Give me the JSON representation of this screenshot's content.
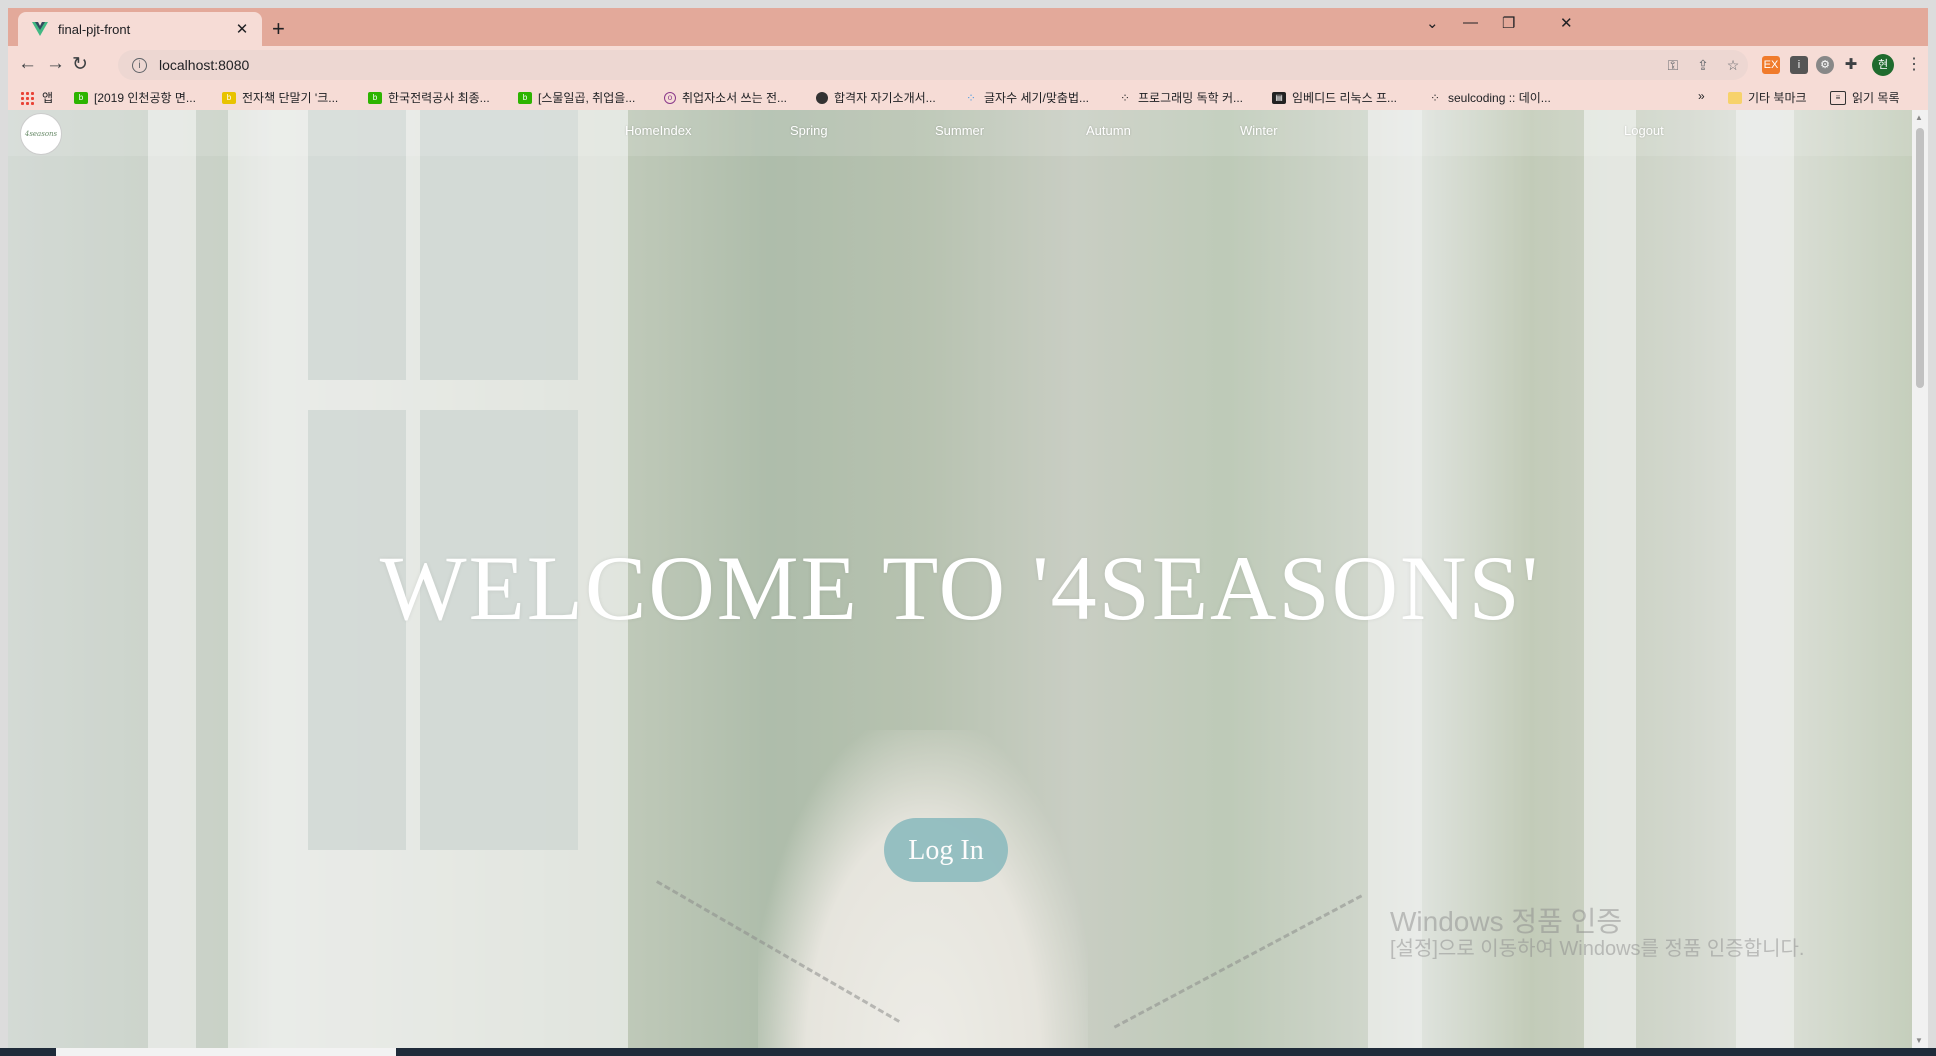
{
  "browser": {
    "tab_title": "final-pjt-front",
    "tab_close": "✕",
    "new_tab": "+",
    "win_min": "—",
    "win_restore": "❐",
    "win_close": "✕",
    "tab_list": "⌄",
    "url": "localhost:8080",
    "nav_back": "←",
    "nav_forward": "→",
    "nav_reload": "↻",
    "profile_initial": "현"
  },
  "bookmarks": {
    "apps": "앱",
    "items": [
      "[2019 인천공항 면...",
      "전자책 단말기 '크...",
      "한국전력공사 최종...",
      "[스물일곱, 취업을...",
      "취업자소서 쓰는 전...",
      "합격자 자기소개서...",
      "글자수 세기/맞춤법...",
      "프로그래밍 독학 커...",
      "임베디드 리눅스 프...",
      "seulcoding :: 데이..."
    ],
    "more": "»",
    "other": "기타 북마크",
    "reading_list": "읽기 목록"
  },
  "site": {
    "logo_text": "4seasons",
    "nav": [
      "HomeIndex",
      "Spring",
      "Summer",
      "Autumn",
      "Winter"
    ],
    "logout": "Logout",
    "welcome": "WELCOME TO '4SEASONS'",
    "login": "Log In"
  },
  "os": {
    "watermark_title": "Windows 정품 인증",
    "watermark_body": "[설정]으로 이동하여 Windows를 정품 인증합니다."
  },
  "colors": {
    "tabbar": "#e3a99a",
    "toolbar": "#f6dcd6",
    "login_button": "#8fbcbf"
  }
}
